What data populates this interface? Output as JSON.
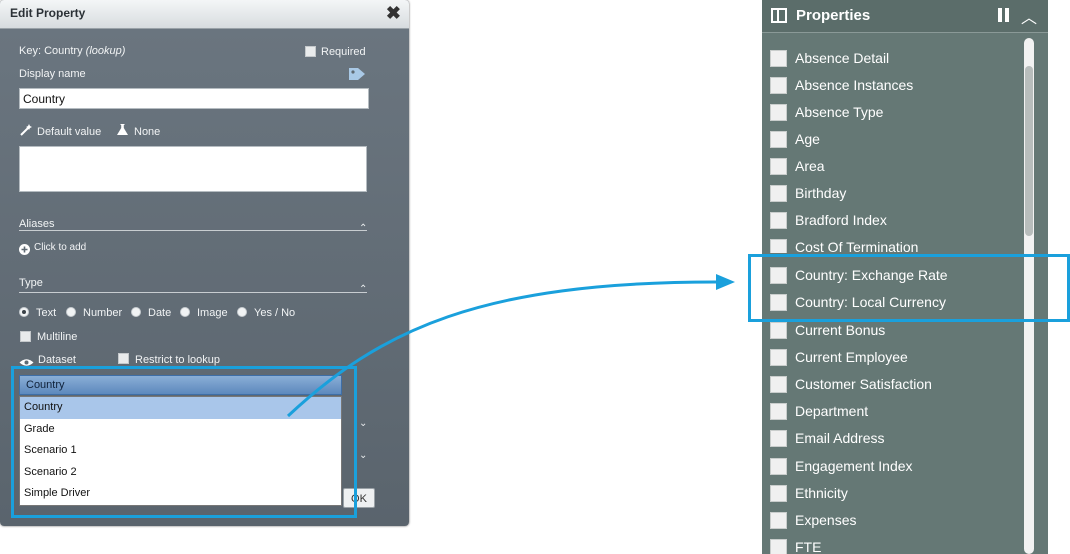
{
  "dialog": {
    "title": "Edit Property",
    "close_glyph": "✖",
    "key_label": "Key: Country",
    "key_suffix": "(lookup)",
    "required_label": "Required",
    "display_name_label": "Display name",
    "display_name_value": "Country",
    "default_value_label": "Default value",
    "none_label": "None",
    "aliases_label": "Aliases",
    "click_to_add": "Click to add",
    "type_label": "Type",
    "type_options": [
      "Text",
      "Number",
      "Date",
      "Image",
      "Yes / No"
    ],
    "type_selected": "Text",
    "multiline_label": "Multiline",
    "dataset_label": "Dataset",
    "restrict_label": "Restrict to lookup",
    "dataset_value": "Country",
    "dataset_options": [
      "Country",
      "Grade",
      "Scenario 1",
      "Scenario 2",
      "Simple Driver"
    ],
    "ok_label": "OK"
  },
  "properties": {
    "title": "Properties",
    "items": [
      "Absence Detail",
      "Absence Instances",
      "Absence Type",
      "Age",
      "Area",
      "Birthday",
      "Bradford Index",
      "Cost Of Termination",
      "Country: Exchange Rate",
      "Country: Local Currency",
      "Current Bonus",
      "Current Employee",
      "Customer Satisfaction",
      "Department",
      "Email Address",
      "Engagement Index",
      "Ethnicity",
      "Expenses",
      "FTE"
    ]
  },
  "colors": {
    "highlight": "#1aa0dc",
    "panel_bg": "#657875",
    "dialog_bg": "#5f6a73"
  }
}
